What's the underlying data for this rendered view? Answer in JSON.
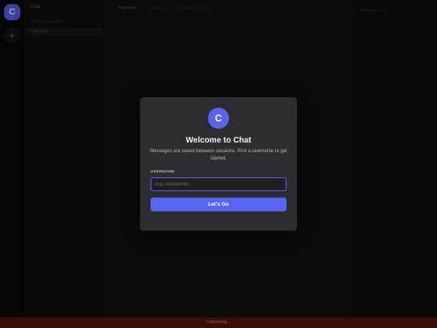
{
  "server": {
    "initial": "C",
    "add_icon": "+"
  },
  "sidebar": {
    "server_name": "Chat",
    "category": "TEXT CHANNELS",
    "channels": [
      {
        "label": "# general"
      }
    ]
  },
  "main": {
    "channel_title": "# general",
    "channel_topic": "Messages are saved between sessions"
  },
  "members": {
    "title": "MEMBERS — 0"
  },
  "modal": {
    "logo_initial": "C",
    "title": "Welcome to Chat",
    "subtitle": "Messages are saved between sessions. Pick a username to get started.",
    "field_label": "USERNAME",
    "input_placeholder": "e.g. cooluser99",
    "input_value": "",
    "button_label": "Let's Go"
  },
  "status": {
    "text": "Connecting..."
  },
  "colors": {
    "accent": "#5865f2",
    "modal_bg": "#2b2d31",
    "status_bar": "#3b0d0d"
  }
}
